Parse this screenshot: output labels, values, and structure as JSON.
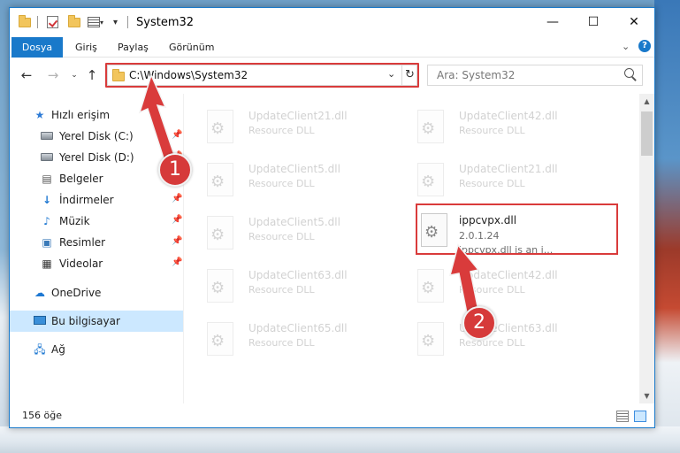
{
  "window": {
    "title": "System32",
    "min_symbol": "—",
    "max_symbol": "☐",
    "close_symbol": "✕"
  },
  "ribbon": {
    "tabs": [
      "Dosya",
      "Giriş",
      "Paylaş",
      "Görünüm"
    ]
  },
  "navigation": {
    "address": "C:\\Windows\\System32",
    "search_placeholder": "Ara: System32"
  },
  "sidebar": {
    "quick_access": "Hızlı erişim",
    "items": [
      {
        "label": "Yerel Disk (C:)",
        "icon": "drive-icon",
        "pinned": true
      },
      {
        "label": "Yerel Disk (D:)",
        "icon": "drive-icon",
        "pinned": true
      },
      {
        "label": "Belgeler",
        "icon": "documents-icon",
        "pinned": true
      },
      {
        "label": "İndirmeler",
        "icon": "downloads-icon",
        "pinned": true
      },
      {
        "label": "Müzik",
        "icon": "music-icon",
        "pinned": true
      },
      {
        "label": "Resimler",
        "icon": "pictures-icon",
        "pinned": true
      },
      {
        "label": "Videolar",
        "icon": "videos-icon",
        "pinned": true
      }
    ],
    "onedrive": "OneDrive",
    "this_pc": "Bu bilgisayar",
    "network": "Ağ"
  },
  "files": {
    "left_column": [
      {
        "name": "UpdateClient21.dll",
        "desc": "Resource DLL"
      },
      {
        "name": "UpdateClient5.dll",
        "desc": "Resource DLL"
      },
      {
        "name": "UpdateClient5.dll",
        "desc": "Resource DLL"
      },
      {
        "name": "UpdateClient63.dll",
        "desc": "Resource DLL"
      },
      {
        "name": "UpdateClient65.dll",
        "desc": "Resource DLL"
      }
    ],
    "right_column": [
      {
        "name": "UpdateClient42.dll",
        "desc": "Resource DLL"
      },
      {
        "name": "UpdateClient21.dll",
        "desc": "Resource DLL"
      },
      {
        "name": "UpdateClient42.dll",
        "desc": "Resource DLL"
      },
      {
        "name": "UpdateClient63.dll",
        "desc": "Resource DLL"
      }
    ],
    "selected": {
      "name": "ippcvpx.dll",
      "version": "2.0.1.24",
      "desc": "ippcvpx.dll is an i..."
    }
  },
  "status": {
    "item_count": "156 öğe"
  },
  "annotations": {
    "step1": "1",
    "step2": "2",
    "color": "#d93b3b"
  }
}
